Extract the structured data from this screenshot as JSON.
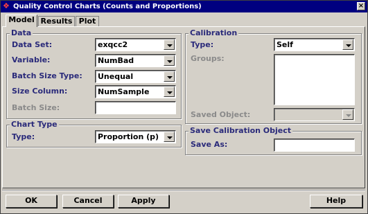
{
  "window": {
    "title": "Quality Control Charts (Counts and Proportions)",
    "close_glyph": "×"
  },
  "tabs": [
    {
      "label": "Model",
      "active": true
    },
    {
      "label": "Results",
      "active": false
    },
    {
      "label": "Plot",
      "active": false
    }
  ],
  "data_group": {
    "title": "Data",
    "data_set": {
      "label": "Data Set:",
      "value": "exqcc2"
    },
    "variable": {
      "label": "Variable:",
      "value": "NumBad"
    },
    "batch_size_type": {
      "label": "Batch Size Type:",
      "value": "Unequal"
    },
    "size_column": {
      "label": "Size Column:",
      "value": "NumSample"
    },
    "batch_size": {
      "label": "Batch Size:",
      "value": ""
    }
  },
  "chart_type_group": {
    "title": "Chart Type",
    "type": {
      "label": "Type:",
      "value": "Proportion (p)"
    }
  },
  "calibration_group": {
    "title": "Calibration",
    "type": {
      "label": "Type:",
      "value": "Self"
    },
    "groups": {
      "label": "Groups:"
    },
    "saved_object": {
      "label": "Saved Object:",
      "value": ""
    }
  },
  "save_group": {
    "title": "Save Calibration Object",
    "save_as": {
      "label": "Save As:",
      "value": ""
    }
  },
  "buttons": {
    "ok": "OK",
    "cancel": "Cancel",
    "apply": "Apply",
    "help": "Help"
  },
  "colors": {
    "titlebar": "#000080",
    "label": "#2a2a7a",
    "dialog": "#d4d0c8"
  }
}
